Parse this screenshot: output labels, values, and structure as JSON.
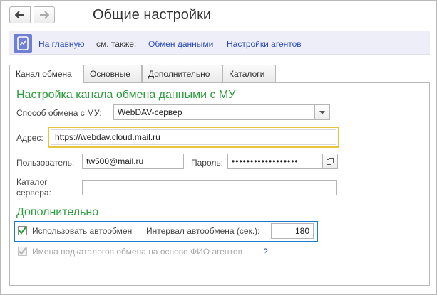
{
  "window": {
    "title": "Общие настройки",
    "back_icon": "arrow-left-icon",
    "forward_icon": "arrow-right-icon"
  },
  "linkbar": {
    "icon": "chart-icon",
    "home_link": "На главную",
    "see_also": "см. также:",
    "exchange_link": "Обмен данными",
    "agents_link": "Настройки агентов"
  },
  "tabs": [
    {
      "label": "Канал обмена",
      "active": true
    },
    {
      "label": "Основные",
      "active": false
    },
    {
      "label": "Дополнительно",
      "active": false
    },
    {
      "label": "Каталоги",
      "active": false
    }
  ],
  "channel": {
    "section_title": "Настройка канала обмена данными с МУ",
    "method_label": "Способ обмена с МУ:",
    "method_value": "WebDAV-сервер",
    "address_label": "Адрес:",
    "address_value": "https://webdav.cloud.mail.ru",
    "user_label": "Пользователь:",
    "user_value": "tw500@mail.ru",
    "password_label": "Пароль:",
    "password_value": "••••••••••••••••••",
    "catalog_label_line1": "Каталог",
    "catalog_label_line2": "сервера:",
    "catalog_value": ""
  },
  "extra": {
    "section_title": "Дополнительно",
    "autoexchange_label": "Использовать автообмен",
    "autoexchange_checked": true,
    "interval_label": "Интервал автообмена (сек.):",
    "interval_value": "180",
    "subcatalog_label": "Имена подкаталогов обмена на основе ФИО агентов",
    "subcatalog_checked": true,
    "help_mark": "?"
  },
  "colors": {
    "accent_green": "#2d9c3c",
    "link_blue": "#2a4bbf",
    "highlight_yellow": "#e8c33e",
    "highlight_blue": "#1b7ccf"
  }
}
